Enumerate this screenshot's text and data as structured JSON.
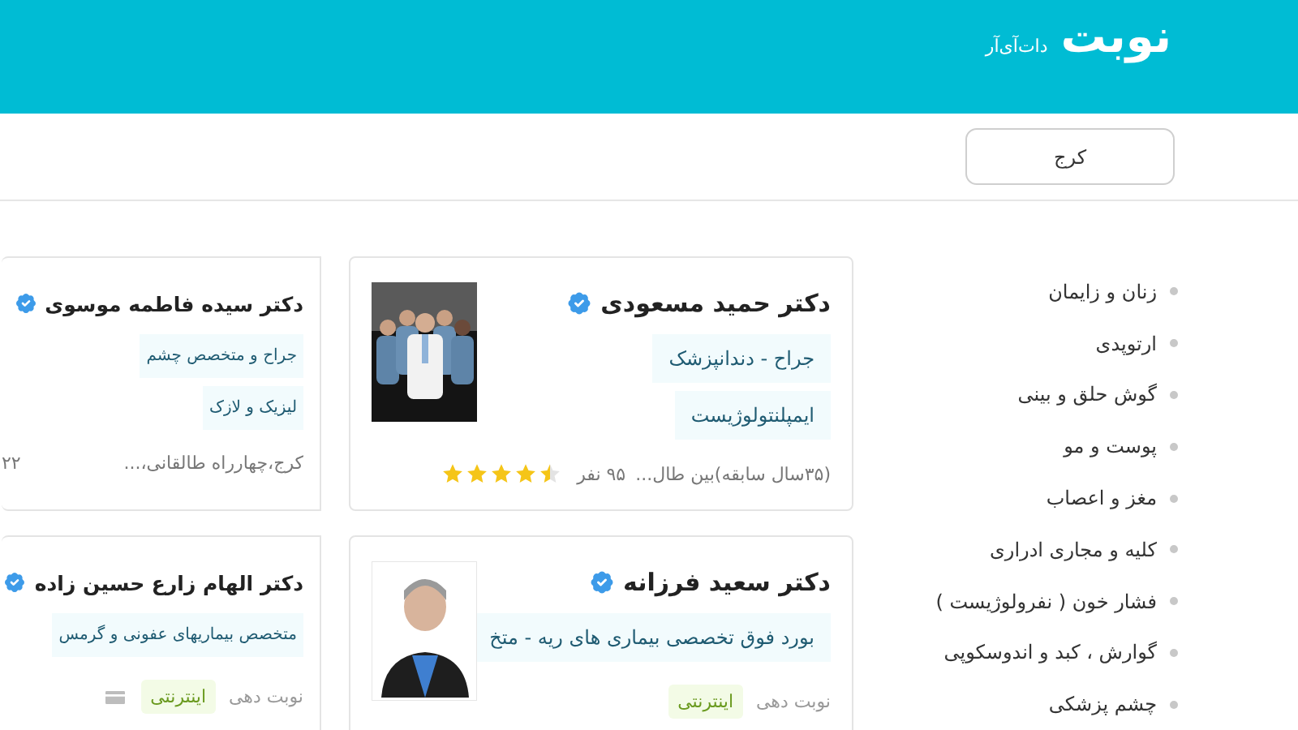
{
  "header": {
    "logo": "نوبت",
    "logo_suffix": "دات‌آی‌آر"
  },
  "city_button": "کرج",
  "categories": [
    "زنان و زایمان",
    "ارتوپدی",
    "گوش حلق و بینی",
    "پوست و مو",
    "مغز و اعصاب",
    "کلیه و مجاری ادراری",
    "فشار خون ( نفرولوژیست )",
    "گوارش ، کبد و اندوسکوپی",
    "چشم پزشکی"
  ],
  "doctors": [
    {
      "name": "دکتر حمید مسعودی",
      "verified": true,
      "tags": [
        "جراح - دندانپزشک",
        "ایمپلنتولوژیست"
      ],
      "info": "(۳۵سال سابقه)بین طال...",
      "count": "۹۵ نفر",
      "stars": 4.5,
      "photo": {
        "kind": "picture"
      }
    },
    {
      "name": "دکتر سیده فاطمه موسوی",
      "verified": true,
      "tags": [
        "جراح و متخصص چشم",
        "لیزیک و لازک"
      ],
      "info": "کرج،چهارراه طالقانی،...",
      "count": "۲۲"
    },
    {
      "name": "دکتر سعید فرزانه",
      "verified": true,
      "tags": [
        "بورد فوق تخصصی بیماری های ریه - متخ"
      ],
      "booking": {
        "label": "نوبت دهی",
        "badge": "اینترنتی",
        "card_payment": false
      },
      "photo": {
        "kind": "picture"
      }
    },
    {
      "name": "دکتر الهام زارع حسین زاده",
      "verified": true,
      "tags": [
        "متخصص بیماریهای عفونی و گرمس"
      ],
      "booking": {
        "label": "نوبت دهی",
        "badge": "اینترنتی",
        "card_payment": true
      }
    }
  ]
}
